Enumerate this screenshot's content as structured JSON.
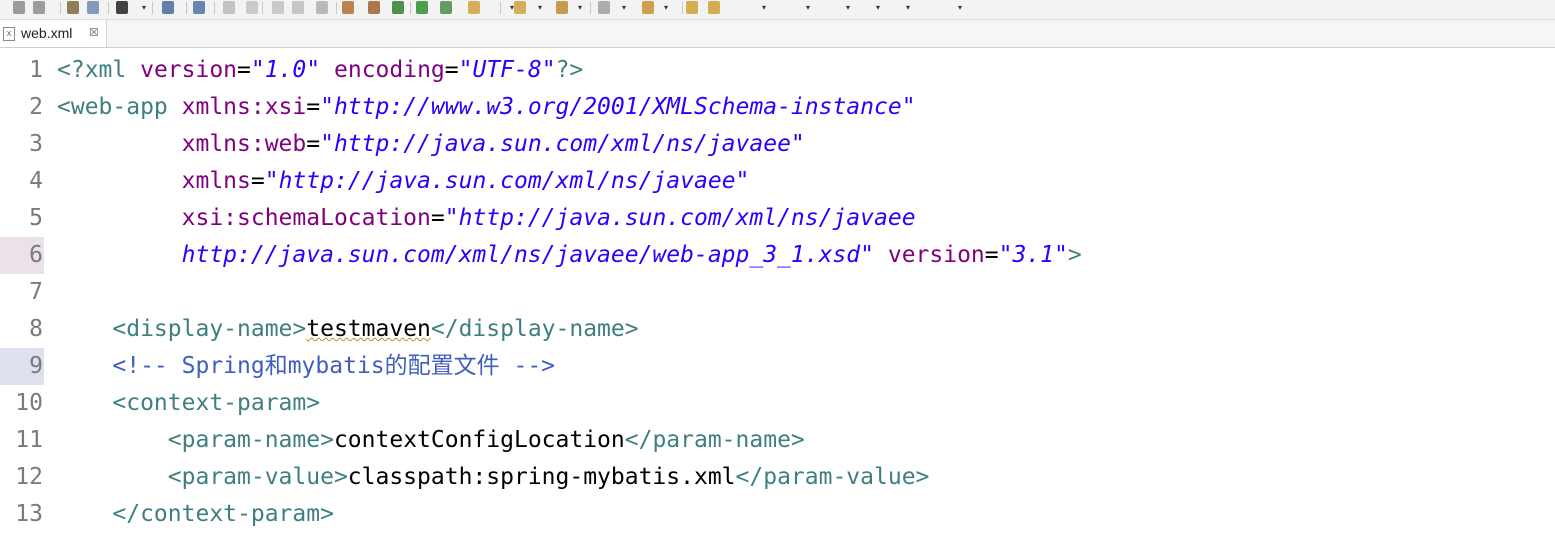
{
  "colors": {
    "tag": "#3f7f7f",
    "attr": "#7f007f",
    "value": "#2a00ff",
    "comment": "#3f5fbf",
    "text": "#000000"
  },
  "toolbar": {
    "icons": [
      "save-icon",
      "save-all-icon",
      "print-icon",
      "link-icon",
      "debug-icon",
      "console-icon",
      "search-icon",
      "run-icon",
      "pause-icon",
      "stop-icon",
      "step-icon",
      "build-icon",
      "new-icon",
      "package-icon",
      "gear-icon",
      "run-green-icon",
      "settings-icon",
      "folder-icon",
      "open-folder-icon",
      "pencil-icon",
      "document-icon",
      "arrow-up-icon",
      "arrow-left-icon",
      "arrow-right-icon"
    ]
  },
  "tab": {
    "label": "web.xml",
    "close": "☒"
  },
  "lines": [
    {
      "n": "1",
      "seg": [
        [
          "t",
          "<?xml "
        ],
        [
          "a",
          "version"
        ],
        [
          "x",
          "="
        ],
        [
          "v",
          "\"1.0\""
        ],
        [
          "x",
          " "
        ],
        [
          "a",
          "encoding"
        ],
        [
          "x",
          "="
        ],
        [
          "v",
          "\"UTF-8\""
        ],
        [
          "t",
          "?>"
        ]
      ]
    },
    {
      "n": "2",
      "seg": [
        [
          "t",
          "<web-app "
        ],
        [
          "a",
          "xmlns:xsi"
        ],
        [
          "x",
          "="
        ],
        [
          "v",
          "\"http://www.w3.org/2001/XMLSchema-instance\""
        ]
      ]
    },
    {
      "n": "3",
      "seg": [
        [
          "x",
          "         "
        ],
        [
          "a",
          "xmlns:web"
        ],
        [
          "x",
          "="
        ],
        [
          "v",
          "\"http://java.sun.com/xml/ns/javaee\""
        ]
      ]
    },
    {
      "n": "4",
      "seg": [
        [
          "x",
          "         "
        ],
        [
          "a",
          "xmlns"
        ],
        [
          "x",
          "="
        ],
        [
          "v",
          "\"http://java.sun.com/xml/ns/javaee\""
        ]
      ]
    },
    {
      "n": "5",
      "seg": [
        [
          "x",
          "         "
        ],
        [
          "a",
          "xsi:schemaLocation"
        ],
        [
          "x",
          "="
        ],
        [
          "v",
          "\"http://java.sun.com/xml/ns/javaee"
        ]
      ]
    },
    {
      "n": "6",
      "seg": [
        [
          "x",
          "         "
        ],
        [
          "v",
          "http://java.sun.com/xml/ns/javaee/web-app_3_1.xsd\""
        ],
        [
          "x",
          " "
        ],
        [
          "a",
          "version"
        ],
        [
          "x",
          "="
        ],
        [
          "v",
          "\"3.1\""
        ],
        [
          "t",
          ">"
        ]
      ]
    },
    {
      "n": "7",
      "seg": []
    },
    {
      "n": "8",
      "seg": [
        [
          "x",
          "    "
        ],
        [
          "t",
          "<display-name>"
        ],
        [
          "sq",
          "testmaven"
        ],
        [
          "t",
          "</display-name>"
        ]
      ]
    },
    {
      "n": "9",
      "seg": [
        [
          "x",
          "    "
        ],
        [
          "c",
          "<!-- Spring和mybatis的配置文件 -->"
        ]
      ]
    },
    {
      "n": "10",
      "seg": [
        [
          "x",
          "    "
        ],
        [
          "t",
          "<context-param>"
        ]
      ]
    },
    {
      "n": "11",
      "seg": [
        [
          "x",
          "        "
        ],
        [
          "t",
          "<param-name>"
        ],
        [
          "x",
          "contextConfigLocation"
        ],
        [
          "t",
          "</param-name>"
        ]
      ]
    },
    {
      "n": "12",
      "seg": [
        [
          "x",
          "        "
        ],
        [
          "t",
          "<param-value>"
        ],
        [
          "x",
          "classpath:spring-mybatis.xml"
        ],
        [
          "t",
          "</param-value>"
        ]
      ]
    },
    {
      "n": "13",
      "seg": [
        [
          "x",
          "    "
        ],
        [
          "t",
          "</context-param>"
        ]
      ]
    }
  ]
}
